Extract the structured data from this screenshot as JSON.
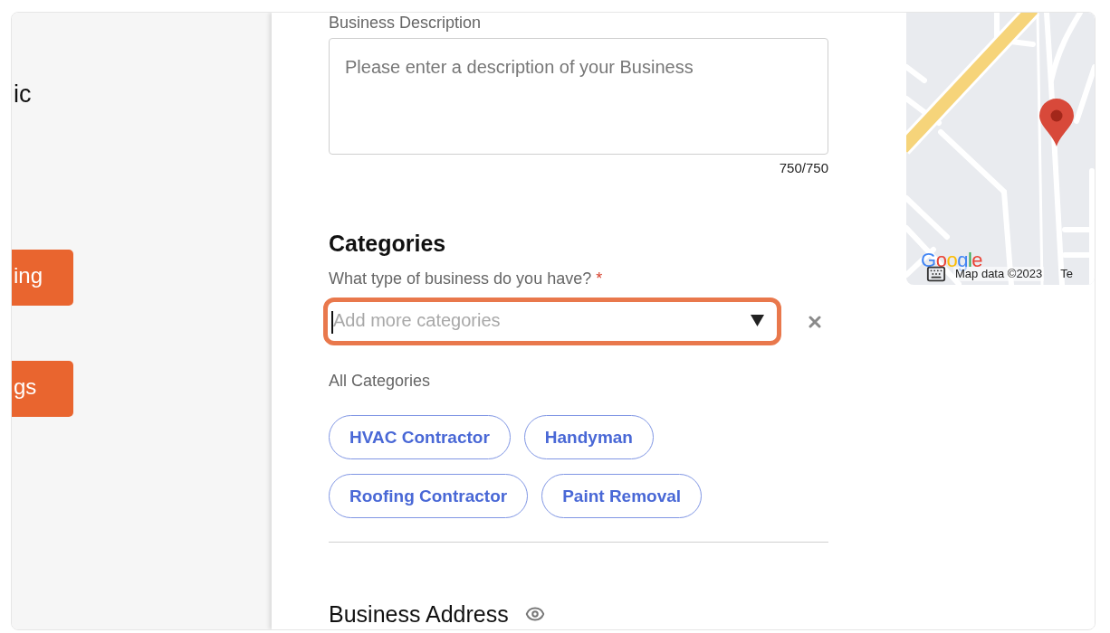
{
  "sidebar": {
    "heading": "ic",
    "buttons": [
      {
        "label": "ing"
      },
      {
        "label": "gs"
      }
    ]
  },
  "description": {
    "label": "Business Description",
    "placeholder": "Please enter a description of your Business",
    "counter": "750/750"
  },
  "categories": {
    "heading": "Categories",
    "question": "What type of business do you have?",
    "required_mark": "*",
    "select": {
      "placeholder": "Add more categories",
      "focused": true
    },
    "list_label": "All Categories",
    "chips": [
      {
        "label": "HVAC Contractor"
      },
      {
        "label": "Handyman"
      },
      {
        "label": "Roofing Contractor"
      },
      {
        "label": "Paint Removal"
      }
    ]
  },
  "address": {
    "heading": "Business Address"
  },
  "map": {
    "logo": "Google",
    "attribution": "Map data ©2023",
    "link": "Te"
  }
}
